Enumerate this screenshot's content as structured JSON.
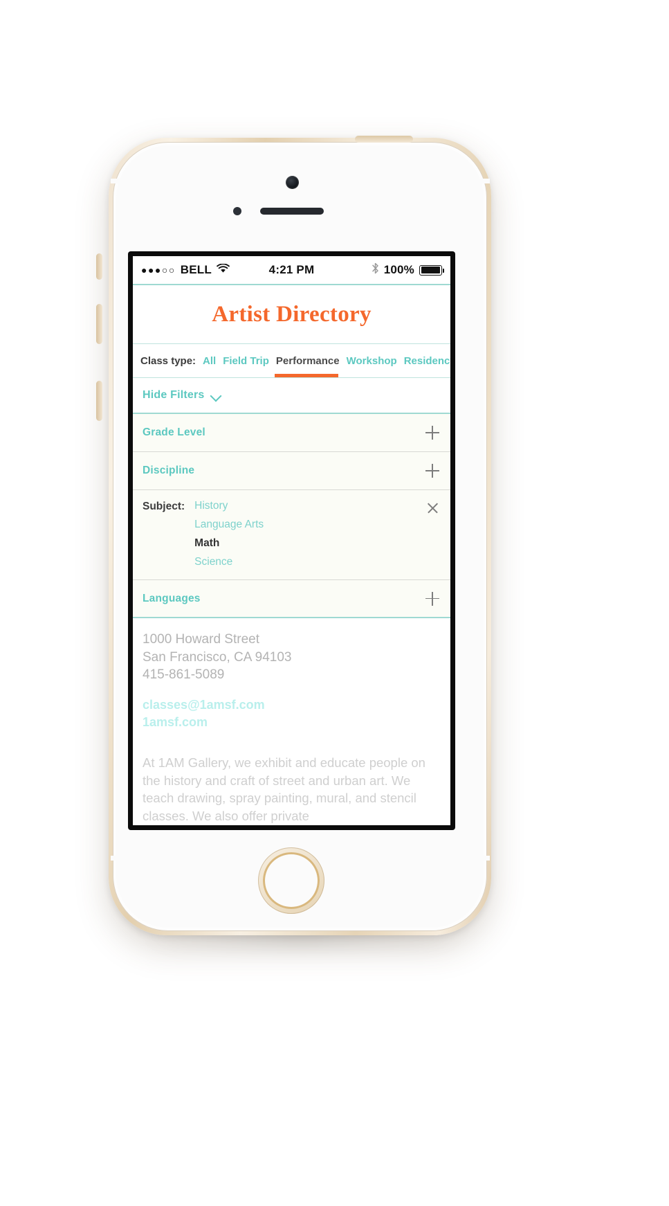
{
  "status_bar": {
    "signal_dots": "●●●○○",
    "carrier": "BELL",
    "wifi_icon": "wifi-icon",
    "time": "4:21 PM",
    "bluetooth_icon": "bluetooth-icon",
    "battery_percent": "100%",
    "battery_icon": "battery-full-icon"
  },
  "header": {
    "title": "Artist Directory"
  },
  "class_type": {
    "label": "Class type:",
    "tabs": [
      {
        "label": "All",
        "active": false
      },
      {
        "label": "Field Trip",
        "active": false
      },
      {
        "label": "Performance",
        "active": true
      },
      {
        "label": "Workshop",
        "active": false
      },
      {
        "label": "Residency",
        "active": false
      }
    ]
  },
  "filters_toggle": {
    "label": "Hide Filters",
    "icon": "chevron-down-icon"
  },
  "filters": [
    {
      "title": "Grade Level",
      "icon": "plus-icon",
      "expanded": false
    },
    {
      "title": "Discipline",
      "icon": "plus-icon",
      "expanded": false
    }
  ],
  "subject_filter": {
    "label": "Subject:",
    "icon": "close-icon",
    "options": [
      {
        "label": "History",
        "selected": false
      },
      {
        "label": "Language Arts",
        "selected": false
      },
      {
        "label": "Math",
        "selected": true
      },
      {
        "label": "Science",
        "selected": false
      }
    ]
  },
  "languages_filter": {
    "title": "Languages",
    "icon": "plus-icon",
    "expanded": false
  },
  "detail": {
    "address_line1": "1000 Howard Street",
    "address_line2": "San Francisco, CA 94103",
    "phone": "415-861-5089",
    "email": "classes@1amsf.com",
    "website": "1amsf.com",
    "description": "At 1AM Gallery, we exhibit and educate people on the history and craft of street and urban art. We teach drawing, spray painting, mural, and stencil classes. We also offer private"
  },
  "colors": {
    "accent_orange": "#f4682c",
    "teal": "#5cc8c0",
    "teal_light": "#7ed2cc",
    "panel_bg": "#fbfcf6"
  }
}
